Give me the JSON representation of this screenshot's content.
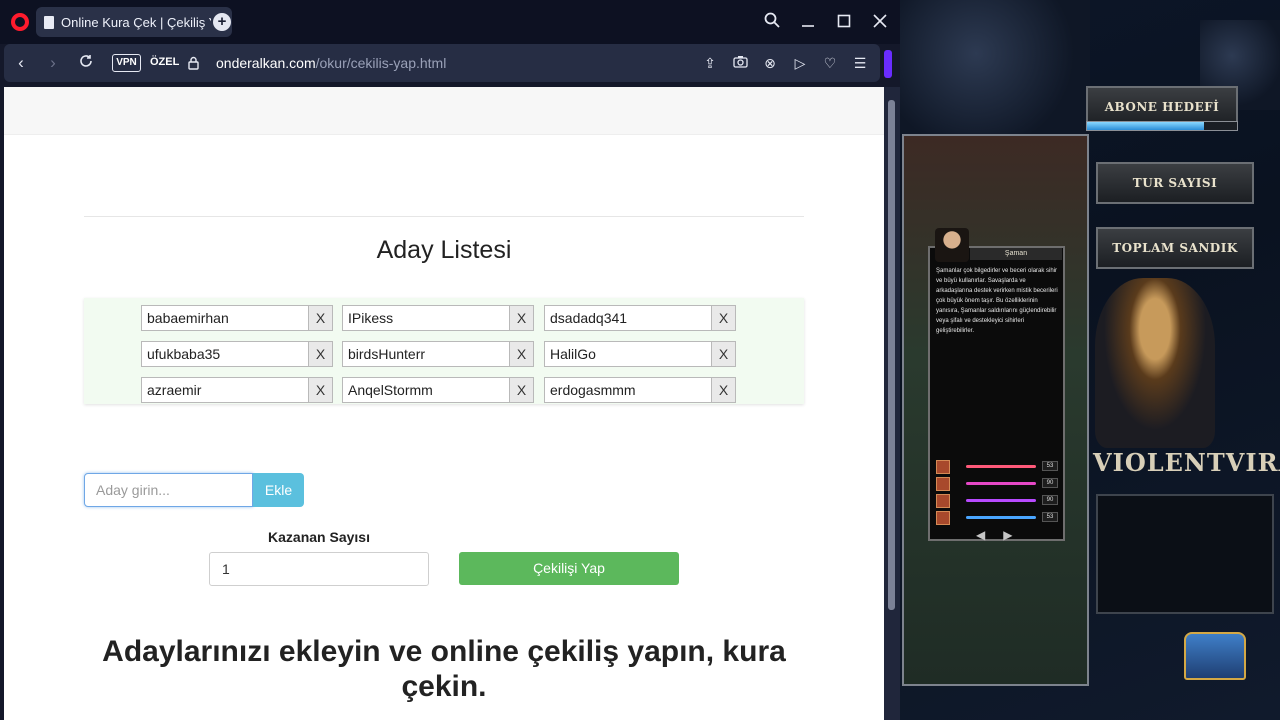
{
  "browser": {
    "tab_title": "Online Kura Çek | Çekiliş Y",
    "vpn_label": "VPN",
    "private_label": "ÖZEL",
    "url_host": "onderalkan.com",
    "url_path": "/okur/cekilis-yap.html"
  },
  "page": {
    "list_title": "Aday Listesi",
    "remove_label": "X",
    "candidates": [
      "babaemirhan",
      "IPikess",
      "dsadadq341",
      "ufukbaba35",
      "birdsHunterr",
      "HalilGo",
      "azraemir",
      "AnqelStormm",
      "erdogasmmm"
    ],
    "add_placeholder": "Aday girin...",
    "add_button": "Ekle",
    "winner_count_label": "Kazanan Sayısı",
    "winner_count_value": "1",
    "draw_button": "Çekilişi Yap",
    "headline": "Adaylarınızı ekleyin ve online çekiliş yapın, kura çekin."
  },
  "game": {
    "menu": [
      "ABONE HEDEFİ",
      "TUR SAYISI",
      "TOPLAM SANDIK"
    ],
    "subscriber_progress": 0.78,
    "char_name": "Şaman",
    "char_desc": "Şamanlar çok bilgedirler ve beceri olarak sihir ve büyü kullanırlar. Savaşlarda ve arkadaşlarına destek verirken mistik becerileri çok büyük önem taşır. Bu özelliklerinin yanısıra, Şamanlar saldırılarını güçlendirebilir veya şifalı ve destekleyici sihirleri geliştirebilirler.",
    "stats": [
      {
        "value": "53",
        "color": "#ff5a7a"
      },
      {
        "value": "90",
        "color": "#e648c7"
      },
      {
        "value": "90",
        "color": "#b84aff"
      },
      {
        "value": "53",
        "color": "#4aa6ff"
      }
    ],
    "brand": "VIOLENTVIRA"
  }
}
